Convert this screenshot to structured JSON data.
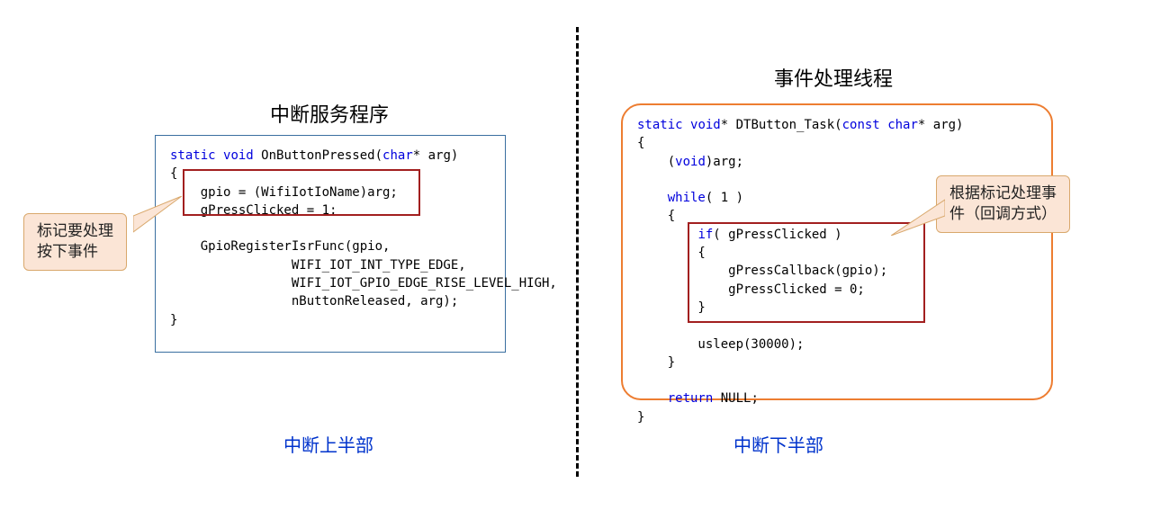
{
  "left": {
    "title": "中断服务程序",
    "footer": "中断上半部",
    "callout": "标记要处理\n按下事件",
    "code": {
      "l1a": "static",
      "l1b": "void",
      "l1c": " OnButtonPressed(",
      "l1d": "char",
      "l1e": "* arg)",
      "l2": "{",
      "l3": "    gpio = (WifiIotIoName)arg;",
      "l4": "    gPressClicked = 1;",
      "l5": "",
      "l6": "    GpioRegisterIsrFunc(gpio,",
      "l7": "                WIFI_IOT_INT_TYPE_EDGE,",
      "l8": "                WIFI_IOT_GPIO_EDGE_RISE_LEVEL_HIGH,",
      "l9": "                nButtonReleased, arg);",
      "l10": "}"
    }
  },
  "right": {
    "title": "事件处理线程",
    "footer": "中断下半部",
    "callout": "根据标记处理事\n件（回调方式）",
    "code": {
      "l1a": "static",
      "l1b": "void",
      "l1c": "* DTButton_Task(",
      "l1d": "const",
      "l1e": "char",
      "l1f": "* arg)",
      "l2": "{",
      "l3a": "    (",
      "l3b": "void",
      "l3c": ")arg;",
      "l4": "",
      "l5a": "    ",
      "l5b": "while",
      "l5c": "( 1 )",
      "l6": "    {",
      "l7a": "        ",
      "l7b": "if",
      "l7c": "( gPressClicked )",
      "l8": "        {",
      "l9": "            gPressCallback(gpio);",
      "l10": "            gPressClicked = 0;",
      "l11": "        }",
      "l12": "",
      "l13": "        usleep(30000);",
      "l14": "    }",
      "l15": "",
      "l16a": "    ",
      "l16b": "return",
      "l16c": " NULL;",
      "l17": "}"
    }
  }
}
